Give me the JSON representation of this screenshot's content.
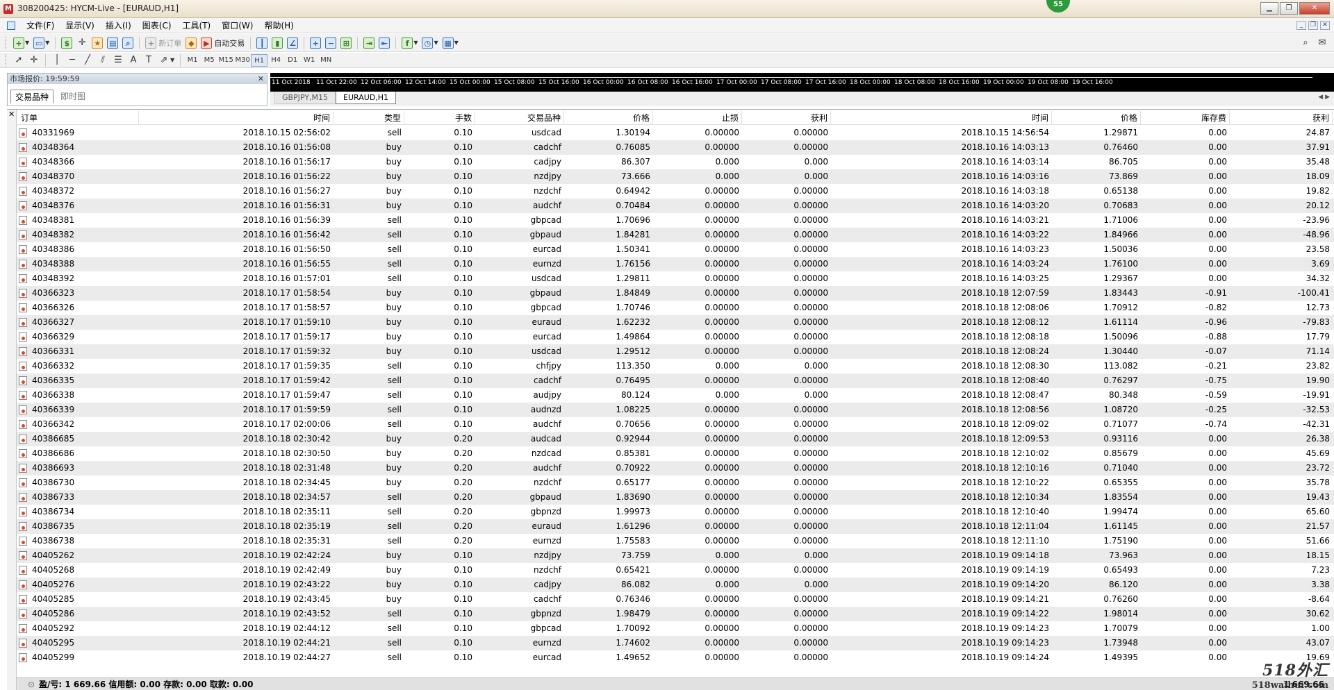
{
  "window": {
    "title": "308200425: HYCM-Live - [EURAUD,H1]",
    "badge": "55"
  },
  "menu": [
    "文件(F)",
    "显示(V)",
    "插入(I)",
    "图表(C)",
    "工具(T)",
    "窗口(W)",
    "帮助(H)"
  ],
  "toolbar": {
    "new_order": "新订单",
    "auto_trading": "自动交易"
  },
  "timeframes": [
    "M1",
    "M5",
    "M15",
    "M30",
    "H1",
    "H4",
    "D1",
    "W1",
    "MN"
  ],
  "active_timeframe": "H1",
  "market_watch": {
    "title": "市场报价: 19:59:59",
    "tab_symbols": "交易品种",
    "tab_tick": "即时图"
  },
  "chart": {
    "time_labels": [
      "11 Oct 2018",
      "11 Oct 22:00",
      "12 Oct 06:00",
      "12 Oct 14:00",
      "15 Oct 00:00",
      "15 Oct 08:00",
      "15 Oct 16:00",
      "16 Oct 00:00",
      "16 Oct 08:00",
      "16 Oct 16:00",
      "17 Oct 00:00",
      "17 Oct 08:00",
      "17 Oct 16:00",
      "18 Oct 00:00",
      "18 Oct 08:00",
      "18 Oct 16:00",
      "19 Oct 00:00",
      "19 Oct 08:00",
      "19 Oct 16:00"
    ],
    "tabs": [
      "GBPJPY,M15",
      "EURAUD,H1"
    ],
    "active_tab": "EURAUD,H1"
  },
  "history": {
    "columns": [
      "订单",
      "时间",
      "类型",
      "手数",
      "交易品种",
      "价格",
      "止损",
      "获利",
      "时间",
      "价格",
      "库存费",
      "获利"
    ],
    "sort_mark": "/",
    "rows": [
      [
        "40331969",
        "2018.10.15 02:56:02",
        "sell",
        "0.10",
        "usdcad",
        "1.30194",
        "0.00000",
        "0.00000",
        "2018.10.15 14:56:54",
        "1.29871",
        "0.00",
        "24.87"
      ],
      [
        "40348364",
        "2018.10.16 01:56:08",
        "buy",
        "0.10",
        "cadchf",
        "0.76085",
        "0.00000",
        "0.00000",
        "2018.10.16 14:03:13",
        "0.76460",
        "0.00",
        "37.91"
      ],
      [
        "40348366",
        "2018.10.16 01:56:17",
        "buy",
        "0.10",
        "cadjpy",
        "86.307",
        "0.000",
        "0.000",
        "2018.10.16 14:03:14",
        "86.705",
        "0.00",
        "35.48"
      ],
      [
        "40348370",
        "2018.10.16 01:56:22",
        "buy",
        "0.10",
        "nzdjpy",
        "73.666",
        "0.000",
        "0.000",
        "2018.10.16 14:03:16",
        "73.869",
        "0.00",
        "18.09"
      ],
      [
        "40348372",
        "2018.10.16 01:56:27",
        "buy",
        "0.10",
        "nzdchf",
        "0.64942",
        "0.00000",
        "0.00000",
        "2018.10.16 14:03:18",
        "0.65138",
        "0.00",
        "19.82"
      ],
      [
        "40348376",
        "2018.10.16 01:56:31",
        "buy",
        "0.10",
        "audchf",
        "0.70484",
        "0.00000",
        "0.00000",
        "2018.10.16 14:03:20",
        "0.70683",
        "0.00",
        "20.12"
      ],
      [
        "40348381",
        "2018.10.16 01:56:39",
        "sell",
        "0.10",
        "gbpcad",
        "1.70696",
        "0.00000",
        "0.00000",
        "2018.10.16 14:03:21",
        "1.71006",
        "0.00",
        "-23.96"
      ],
      [
        "40348382",
        "2018.10.16 01:56:42",
        "sell",
        "0.10",
        "gbpaud",
        "1.84281",
        "0.00000",
        "0.00000",
        "2018.10.16 14:03:22",
        "1.84966",
        "0.00",
        "-48.96"
      ],
      [
        "40348386",
        "2018.10.16 01:56:50",
        "sell",
        "0.10",
        "eurcad",
        "1.50341",
        "0.00000",
        "0.00000",
        "2018.10.16 14:03:23",
        "1.50036",
        "0.00",
        "23.58"
      ],
      [
        "40348388",
        "2018.10.16 01:56:55",
        "sell",
        "0.10",
        "eurnzd",
        "1.76156",
        "0.00000",
        "0.00000",
        "2018.10.16 14:03:24",
        "1.76100",
        "0.00",
        "3.69"
      ],
      [
        "40348392",
        "2018.10.16 01:57:01",
        "sell",
        "0.10",
        "usdcad",
        "1.29811",
        "0.00000",
        "0.00000",
        "2018.10.16 14:03:25",
        "1.29367",
        "0.00",
        "34.32"
      ],
      [
        "40366323",
        "2018.10.17 01:58:54",
        "buy",
        "0.10",
        "gbpaud",
        "1.84849",
        "0.00000",
        "0.00000",
        "2018.10.18 12:07:59",
        "1.83443",
        "-0.91",
        "-100.41"
      ],
      [
        "40366326",
        "2018.10.17 01:58:57",
        "buy",
        "0.10",
        "gbpcad",
        "1.70746",
        "0.00000",
        "0.00000",
        "2018.10.18 12:08:06",
        "1.70912",
        "-0.82",
        "12.73"
      ],
      [
        "40366327",
        "2018.10.17 01:59:10",
        "buy",
        "0.10",
        "euraud",
        "1.62232",
        "0.00000",
        "0.00000",
        "2018.10.18 12:08:12",
        "1.61114",
        "-0.96",
        "-79.83"
      ],
      [
        "40366329",
        "2018.10.17 01:59:17",
        "buy",
        "0.10",
        "eurcad",
        "1.49864",
        "0.00000",
        "0.00000",
        "2018.10.18 12:08:18",
        "1.50096",
        "-0.88",
        "17.79"
      ],
      [
        "40366331",
        "2018.10.17 01:59:32",
        "buy",
        "0.10",
        "usdcad",
        "1.29512",
        "0.00000",
        "0.00000",
        "2018.10.18 12:08:24",
        "1.30440",
        "-0.07",
        "71.14"
      ],
      [
        "40366332",
        "2018.10.17 01:59:35",
        "sell",
        "0.10",
        "chfjpy",
        "113.350",
        "0.000",
        "0.000",
        "2018.10.18 12:08:30",
        "113.082",
        "-0.21",
        "23.82"
      ],
      [
        "40366335",
        "2018.10.17 01:59:42",
        "sell",
        "0.10",
        "cadchf",
        "0.76495",
        "0.00000",
        "0.00000",
        "2018.10.18 12:08:40",
        "0.76297",
        "-0.75",
        "19.90"
      ],
      [
        "40366338",
        "2018.10.17 01:59:47",
        "sell",
        "0.10",
        "audjpy",
        "80.124",
        "0.000",
        "0.000",
        "2018.10.18 12:08:47",
        "80.348",
        "-0.59",
        "-19.91"
      ],
      [
        "40366339",
        "2018.10.17 01:59:59",
        "sell",
        "0.10",
        "audnzd",
        "1.08225",
        "0.00000",
        "0.00000",
        "2018.10.18 12:08:56",
        "1.08720",
        "-0.25",
        "-32.53"
      ],
      [
        "40366342",
        "2018.10.17 02:00:06",
        "sell",
        "0.10",
        "audchf",
        "0.70656",
        "0.00000",
        "0.00000",
        "2018.10.18 12:09:02",
        "0.71077",
        "-0.74",
        "-42.31"
      ],
      [
        "40386685",
        "2018.10.18 02:30:42",
        "buy",
        "0.20",
        "audcad",
        "0.92944",
        "0.00000",
        "0.00000",
        "2018.10.18 12:09:53",
        "0.93116",
        "0.00",
        "26.38"
      ],
      [
        "40386686",
        "2018.10.18 02:30:50",
        "buy",
        "0.20",
        "nzdcad",
        "0.85381",
        "0.00000",
        "0.00000",
        "2018.10.18 12:10:02",
        "0.85679",
        "0.00",
        "45.69"
      ],
      [
        "40386693",
        "2018.10.18 02:31:48",
        "buy",
        "0.20",
        "audchf",
        "0.70922",
        "0.00000",
        "0.00000",
        "2018.10.18 12:10:16",
        "0.71040",
        "0.00",
        "23.72"
      ],
      [
        "40386730",
        "2018.10.18 02:34:45",
        "buy",
        "0.20",
        "nzdchf",
        "0.65177",
        "0.00000",
        "0.00000",
        "2018.10.18 12:10:22",
        "0.65355",
        "0.00",
        "35.78"
      ],
      [
        "40386733",
        "2018.10.18 02:34:57",
        "sell",
        "0.20",
        "gbpaud",
        "1.83690",
        "0.00000",
        "0.00000",
        "2018.10.18 12:10:34",
        "1.83554",
        "0.00",
        "19.43"
      ],
      [
        "40386734",
        "2018.10.18 02:35:11",
        "sell",
        "0.20",
        "gbpnzd",
        "1.99973",
        "0.00000",
        "0.00000",
        "2018.10.18 12:10:40",
        "1.99474",
        "0.00",
        "65.60"
      ],
      [
        "40386735",
        "2018.10.18 02:35:19",
        "sell",
        "0.20",
        "euraud",
        "1.61296",
        "0.00000",
        "0.00000",
        "2018.10.18 12:11:04",
        "1.61145",
        "0.00",
        "21.57"
      ],
      [
        "40386738",
        "2018.10.18 02:35:31",
        "sell",
        "0.20",
        "eurnzd",
        "1.75583",
        "0.00000",
        "0.00000",
        "2018.10.18 12:11:10",
        "1.75190",
        "0.00",
        "51.66"
      ],
      [
        "40405262",
        "2018.10.19 02:42:24",
        "buy",
        "0.10",
        "nzdjpy",
        "73.759",
        "0.000",
        "0.000",
        "2018.10.19 09:14:18",
        "73.963",
        "0.00",
        "18.15"
      ],
      [
        "40405268",
        "2018.10.19 02:42:49",
        "buy",
        "0.10",
        "nzdchf",
        "0.65421",
        "0.00000",
        "0.00000",
        "2018.10.19 09:14:19",
        "0.65493",
        "0.00",
        "7.23"
      ],
      [
        "40405276",
        "2018.10.19 02:43:22",
        "buy",
        "0.10",
        "cadjpy",
        "86.082",
        "0.000",
        "0.000",
        "2018.10.19 09:14:20",
        "86.120",
        "0.00",
        "3.38"
      ],
      [
        "40405285",
        "2018.10.19 02:43:45",
        "buy",
        "0.10",
        "cadchf",
        "0.76346",
        "0.00000",
        "0.00000",
        "2018.10.19 09:14:21",
        "0.76260",
        "0.00",
        "-8.64"
      ],
      [
        "40405286",
        "2018.10.19 02:43:52",
        "sell",
        "0.10",
        "gbpnzd",
        "1.98479",
        "0.00000",
        "0.00000",
        "2018.10.19 09:14:22",
        "1.98014",
        "0.00",
        "30.62"
      ],
      [
        "40405292",
        "2018.10.19 02:44:12",
        "sell",
        "0.10",
        "gbpcad",
        "1.70092",
        "0.00000",
        "0.00000",
        "2018.10.19 09:14:23",
        "1.70079",
        "0.00",
        "1.00"
      ],
      [
        "40405295",
        "2018.10.19 02:44:21",
        "sell",
        "0.10",
        "eurnzd",
        "1.74602",
        "0.00000",
        "0.00000",
        "2018.10.19 09:14:23",
        "1.73948",
        "0.00",
        "43.07"
      ],
      [
        "40405299",
        "2018.10.19 02:44:27",
        "sell",
        "0.10",
        "eurcad",
        "1.49652",
        "0.00000",
        "0.00000",
        "2018.10.19 09:14:24",
        "1.49395",
        "0.00",
        "19.69"
      ]
    ],
    "footer": {
      "summary": "盈/亏: 1 669.66  信用额: 0.00  存款: 0.00  取款: 0.00",
      "total": "1 669.66"
    }
  },
  "watermark": {
    "line1": "518外汇",
    "line2": "518waihui.com"
  }
}
